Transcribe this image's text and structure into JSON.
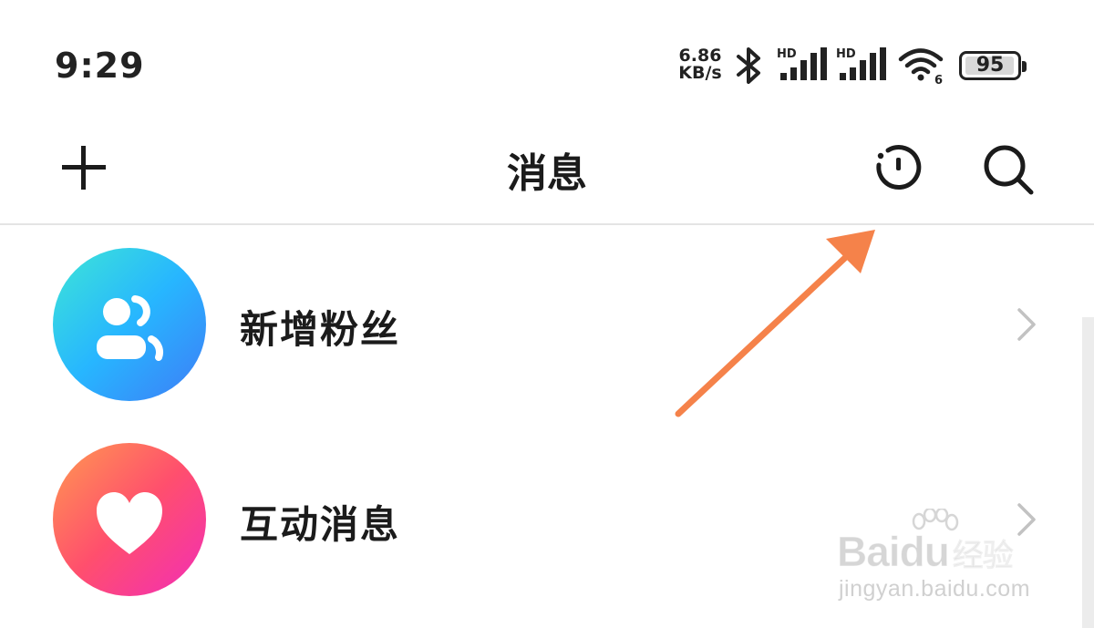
{
  "status_bar": {
    "time": "9:29",
    "net_speed_value": "6.86",
    "net_speed_unit": "KB/s",
    "signal_1_label": "HD",
    "signal_2_label": "HD",
    "wifi_badge": "6",
    "battery_level": "95"
  },
  "header": {
    "title": "消息",
    "left_icon": "plus-icon",
    "right_icons": [
      "history-icon",
      "search-icon"
    ]
  },
  "list": {
    "items": [
      {
        "label": "新增粉丝",
        "icon": "new-fans-icon",
        "accent_gradient": [
          "#3ee6d6",
          "#27b6ff",
          "#3e7cf6"
        ]
      },
      {
        "label": "互动消息",
        "icon": "heart-icon",
        "accent_gradient": [
          "#ff9a50",
          "#ff4f6d",
          "#f22db8"
        ]
      }
    ]
  },
  "annotation": {
    "color": "#f5824a"
  },
  "watermark": {
    "brand": "Bai",
    "brand_tail": "du",
    "brand_cn": "经验",
    "url": "jingyan.baidu.com"
  }
}
